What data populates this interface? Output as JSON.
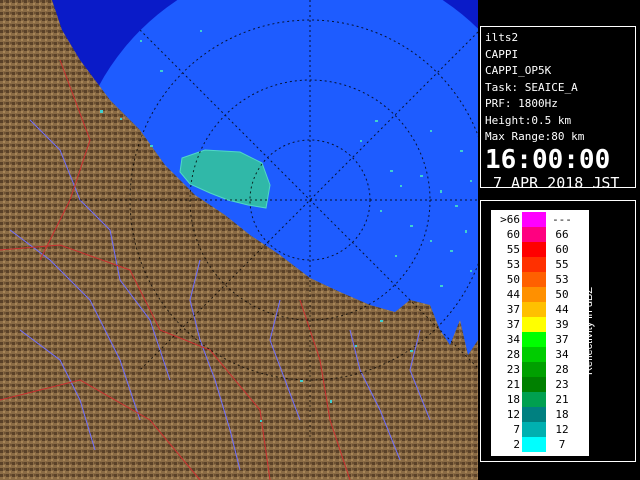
{
  "info": {
    "station": "ilts2",
    "product": "CAPPI",
    "product_code": "CAPPI_OP5K",
    "task": "Task: SEAICE_A",
    "prf": "PRF: 1800Hz",
    "height": "Height:0.5 km",
    "max_range": "Max Range:80 km",
    "time": "16:00:00",
    "date": "7 APR 2018 JST"
  },
  "legend": {
    "title": "Reflectivity in dBZ",
    "rows": [
      {
        "lo": ">66",
        "hi": "---",
        "color": "#ff00ff"
      },
      {
        "lo": "60",
        "hi": "66",
        "color": "#ff0080"
      },
      {
        "lo": "55",
        "hi": "60",
        "color": "#ff0000"
      },
      {
        "lo": "53",
        "hi": "55",
        "color": "#ff3000"
      },
      {
        "lo": "50",
        "hi": "53",
        "color": "#ff6000"
      },
      {
        "lo": "44",
        "hi": "50",
        "color": "#ff9000"
      },
      {
        "lo": "37",
        "hi": "44",
        "color": "#ffc000"
      },
      {
        "lo": "37",
        "hi": "39",
        "color": "#ffff00"
      },
      {
        "lo": "34",
        "hi": "37",
        "color": "#00ff00"
      },
      {
        "lo": "28",
        "hi": "34",
        "color": "#00cc00"
      },
      {
        "lo": "23",
        "hi": "28",
        "color": "#00a000"
      },
      {
        "lo": "21",
        "hi": "23",
        "color": "#008000"
      },
      {
        "lo": "18",
        "hi": "21",
        "color": "#00a050"
      },
      {
        "lo": "12",
        "hi": "18",
        "color": "#008080"
      },
      {
        "lo": "7",
        "hi": "12",
        "color": "#00b0b0"
      },
      {
        "lo": "2",
        "hi": "7",
        "color": "#00ffff"
      }
    ]
  },
  "colors": {
    "radar_disc": "#1e5cff",
    "radar_disc_edge": "#3a78ff",
    "outside_sea": "#0a1bc8",
    "land": "#8a6b45",
    "land_dark": "#4a3522",
    "river": "#7070ff",
    "border": "#cc3030",
    "echo_light": "#40d0d0",
    "echo_mid": "#20a8a8",
    "ice_patch": "#30b8a8"
  }
}
